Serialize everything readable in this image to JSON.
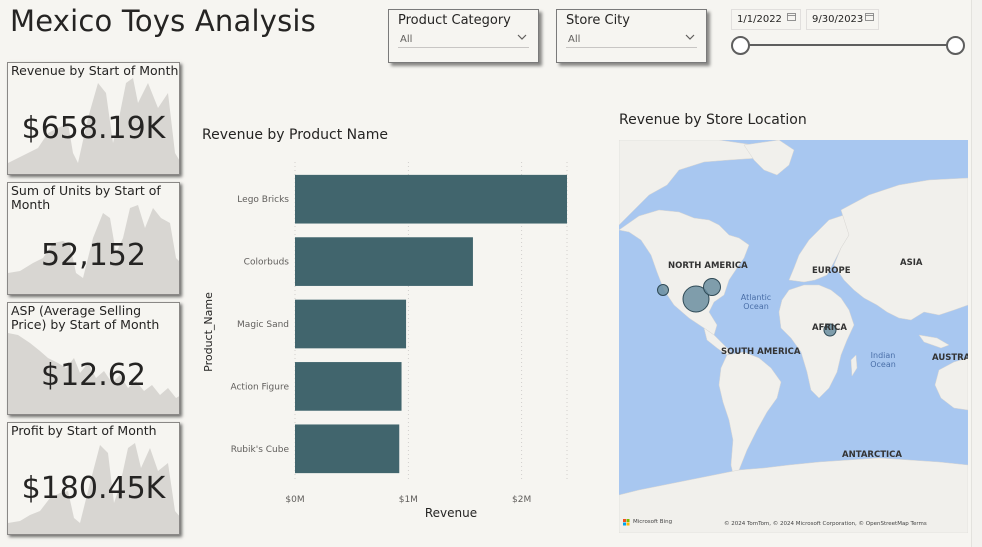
{
  "page_title": "Mexico Toys Analysis",
  "slicers": {
    "category": {
      "title": "Product Category",
      "value": "All"
    },
    "city": {
      "title": "Store City",
      "value": "All"
    }
  },
  "date_range": {
    "start": "1/1/2022",
    "end": "9/30/2023"
  },
  "kpis": [
    {
      "title": "Revenue by Start of Month",
      "value": "$658.19K"
    },
    {
      "title": "Sum of Units by Start of Month",
      "value": "52,152"
    },
    {
      "title": "ASP (Average Selling Price) by Start of Month",
      "value": "$12.62"
    },
    {
      "title": "Profit by Start of Month",
      "value": "$180.45K"
    }
  ],
  "bar_chart": {
    "title": "Revenue by Product Name"
  },
  "chart_data": {
    "type": "bar",
    "orientation": "horizontal",
    "title": "Revenue by Product Name",
    "categories": [
      "Lego Bricks",
      "Colorbuds",
      "Magic Sand",
      "Action Figure",
      "Rubik's Cube"
    ],
    "values": [
      2400000,
      1570000,
      980000,
      940000,
      920000
    ],
    "xlabel": "Revenue",
    "ylabel": "Product_Name",
    "xlim": [
      0,
      2400000
    ],
    "xticks": [
      "$0M",
      "$1M",
      "$2M"
    ],
    "xtick_values": [
      0,
      1000000,
      2000000
    ],
    "bar_color": "#41656d",
    "grid": "vertical dotted"
  },
  "map": {
    "title": "Revenue by Store Location",
    "continents": [
      "NORTH AMERICA",
      "EUROPE",
      "ASIA",
      "AFRICA",
      "SOUTH AMERICA",
      "AUSTRAL",
      "ANTARCTICA"
    ],
    "oceans": {
      "atlantic": "Atlantic Ocean",
      "indian": "Indian Ocean"
    },
    "attribution": "© 2024 TomTom, © 2024 Microsoft Corporation, © OpenStreetMap Terms",
    "provider": "Microsoft Bing",
    "bubble_color": "#6b8ea0"
  },
  "colors": {
    "accent": "#41656d",
    "background": "#f6f5f1",
    "sparkline": "#d8d6d2"
  }
}
